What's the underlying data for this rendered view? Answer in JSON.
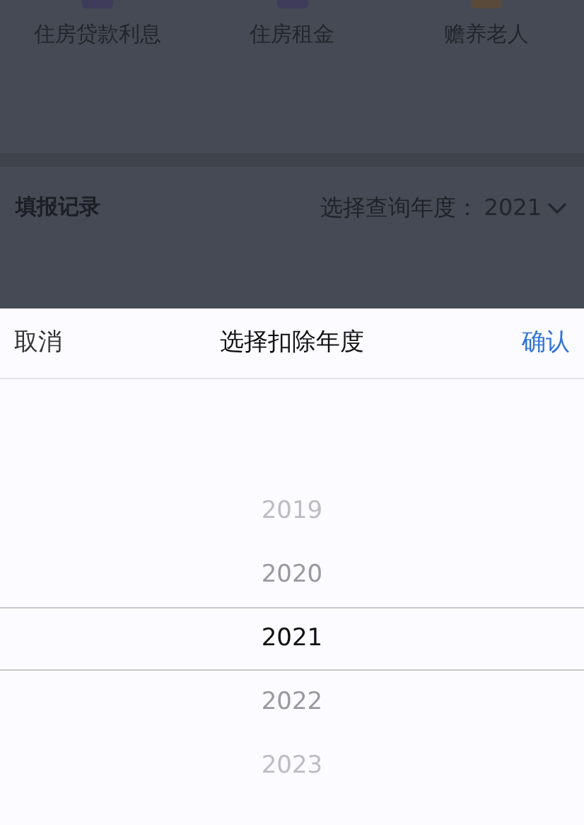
{
  "categories": [
    {
      "label": "住房贷款利息"
    },
    {
      "label": "住房租金"
    },
    {
      "label": "赡养老人"
    }
  ],
  "records": {
    "title": "填报记录",
    "query_label": "选择查询年度：",
    "query_year": "2021"
  },
  "picker": {
    "cancel": "取消",
    "title": "选择扣除年度",
    "confirm": "确认",
    "options": [
      {
        "label": "2019",
        "selected": false
      },
      {
        "label": "2020",
        "selected": false
      },
      {
        "label": "2021",
        "selected": true
      },
      {
        "label": "2022",
        "selected": false
      },
      {
        "label": "2023",
        "selected": false
      }
    ]
  }
}
